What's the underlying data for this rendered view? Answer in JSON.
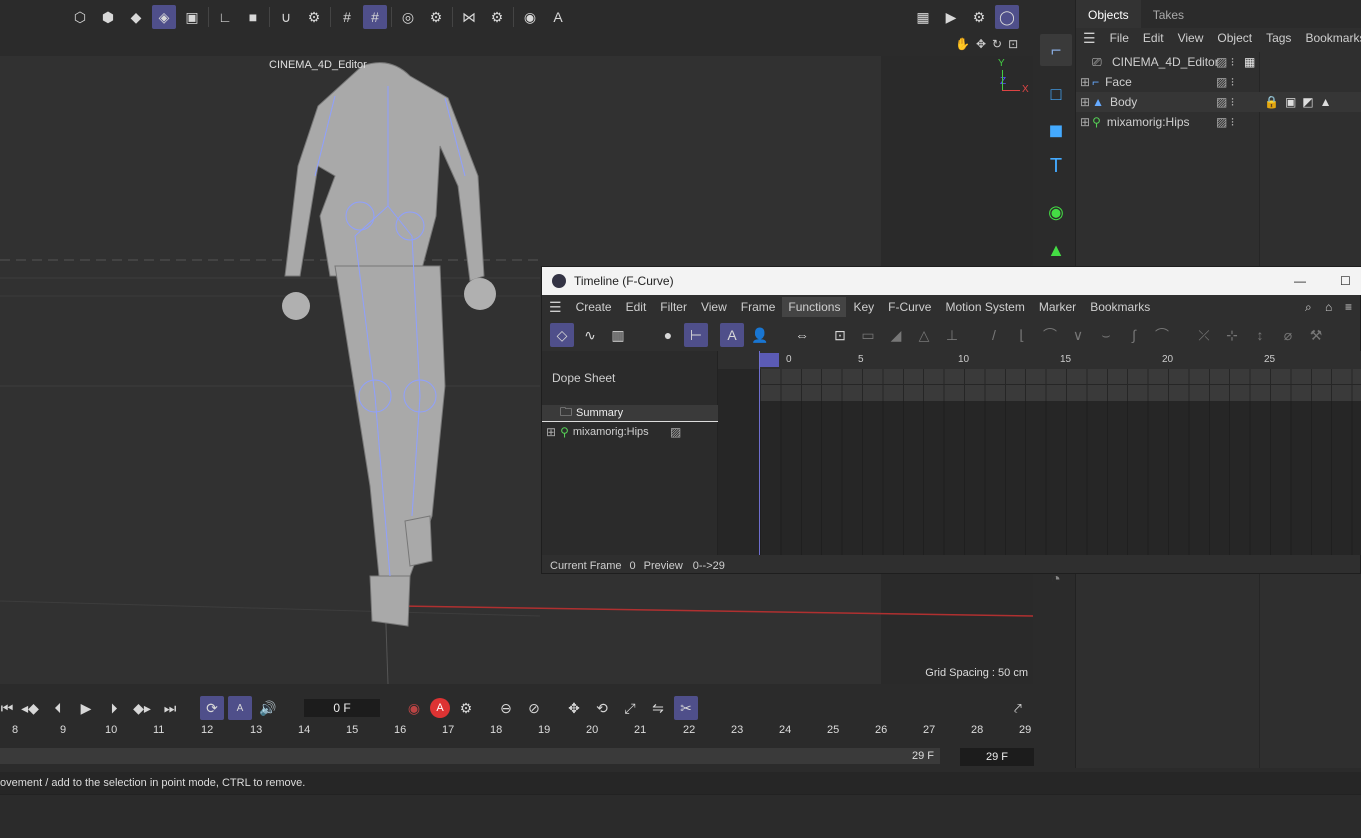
{
  "top_toolbar": {
    "icons": [
      "point-mode-icon",
      "edge-mode-icon",
      "polygon-mode-icon",
      "object-mode-icon",
      "model-mode-icon",
      "axis-icon",
      "solo-icon",
      "magnet-icon",
      "snap-settings-icon",
      "grid-icon",
      "workplane-icon",
      "render-region-icon",
      "settings-icon",
      "symmetry-icon",
      "quantize-icon",
      "view-icon",
      "auto-icon"
    ],
    "right_icons": [
      "render-view-icon",
      "render-picture-icon",
      "render-settings-icon",
      "redshift-icon"
    ]
  },
  "viewport": {
    "camera_label": "CINEMA_4D_Editor",
    "grid_spacing": "Grid Spacing : 50 cm",
    "axis_y": "Y",
    "axis_z": "Z",
    "axis_x": "X"
  },
  "objects_panel": {
    "tabs": [
      "Objects",
      "Takes"
    ],
    "menu": [
      "File",
      "Edit",
      "View",
      "Object",
      "Tags",
      "Bookmarks"
    ],
    "items": [
      {
        "name": "CINEMA_4D_Editor",
        "icon": "camera-icon"
      },
      {
        "name": "Face",
        "icon": "null-icon"
      },
      {
        "name": "Body",
        "icon": "mesh-icon"
      },
      {
        "name": "mixamorig:Hips",
        "icon": "joint-icon"
      }
    ]
  },
  "timeline_window": {
    "title": "Timeline (F-Curve)",
    "menu": [
      "Create",
      "Edit",
      "Filter",
      "View",
      "Frame",
      "Functions",
      "Key",
      "F-Curve",
      "Motion System",
      "Marker",
      "Bookmarks"
    ],
    "active_menu": "Functions",
    "mode_label": "Dope Sheet",
    "summary_label": "Summary",
    "track_label": "mixamorig:Hips",
    "ruler": [
      "0",
      "5",
      "10",
      "15",
      "20",
      "25"
    ],
    "status": {
      "current_frame_label": "Current Frame",
      "current_frame": "0",
      "preview_label": "Preview",
      "preview_range": "0-->29"
    }
  },
  "transport": {
    "frame_field": "0 F",
    "end_frame": "29 F",
    "end_field": "29 F",
    "ruler": [
      "8",
      "9",
      "10",
      "11",
      "12",
      "13",
      "14",
      "15",
      "16",
      "17",
      "18",
      "19",
      "20",
      "21",
      "22",
      "23",
      "24",
      "25",
      "26",
      "27",
      "28",
      "29"
    ]
  },
  "status_bar": {
    "text": "ovement / add to the selection in point mode, CTRL to remove."
  },
  "colors": {
    "accent": "#5b5bb5",
    "bg": "#2b2b2b",
    "panel": "#333333",
    "timeline_bg": "#2f2f2f"
  }
}
